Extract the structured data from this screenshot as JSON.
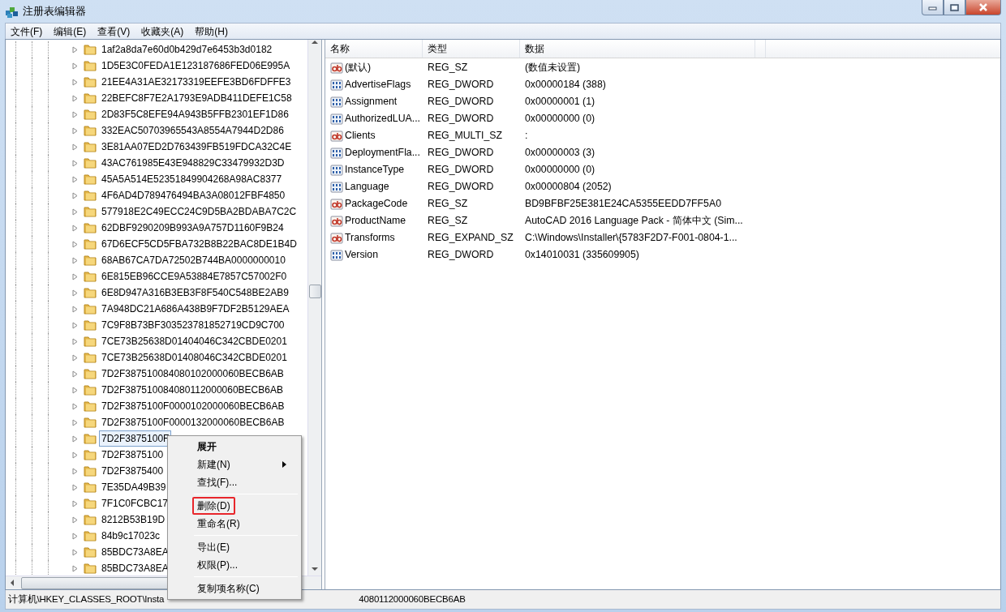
{
  "window": {
    "title": "注册表编辑器"
  },
  "menu_bar": [
    "文件(F)",
    "编辑(E)",
    "查看(V)",
    "收藏夹(A)",
    "帮助(H)"
  ],
  "tree": {
    "items": [
      {
        "label": "1af2a8da7e60d0b429d7e6453b3d0182",
        "selected": false
      },
      {
        "label": "1D5E3C0FEDA1E123187686FED06E995A",
        "selected": false
      },
      {
        "label": "21EE4A31AE32173319EEFE3BD6FDFFE3",
        "selected": false
      },
      {
        "label": "22BEFC8F7E2A1793E9ADB411DEFE1C58",
        "selected": false
      },
      {
        "label": "2D83F5C8EFE94A943B5FFB2301EF1D86",
        "selected": false
      },
      {
        "label": "332EAC50703965543A8554A7944D2D86",
        "selected": false
      },
      {
        "label": "3E81AA07ED2D763439FB519FDCA32C4E",
        "selected": false
      },
      {
        "label": "43AC761985E43E948829C33479932D3D",
        "selected": false
      },
      {
        "label": "45A5A514E52351849904268A98AC8377",
        "selected": false
      },
      {
        "label": "4F6AD4D789476494BA3A08012FBF4850",
        "selected": false
      },
      {
        "label": "577918E2C49ECC24C9D5BA2BDABA7C2C",
        "selected": false
      },
      {
        "label": "62DBF9290209B993A9A757D1160F9B24",
        "selected": false
      },
      {
        "label": "67D6ECF5CD5FBA732B8B22BAC8DE1B4D",
        "selected": false
      },
      {
        "label": "68AB67CA7DA72502B744BA0000000010",
        "selected": false
      },
      {
        "label": "6E815EB96CCE9A53884E7857C57002F0",
        "selected": false
      },
      {
        "label": "6E8D947A316B3EB3F8F540C548BE2AB9",
        "selected": false
      },
      {
        "label": "7A948DC21A686A438B9F7DF2B5129AEA",
        "selected": false
      },
      {
        "label": "7C9F8B73BF303523781852719CD9C700",
        "selected": false
      },
      {
        "label": "7CE73B25638D01404046C342CBDE0201",
        "selected": false
      },
      {
        "label": "7CE73B25638D01408046C342CBDE0201",
        "selected": false
      },
      {
        "label": "7D2F387510084080102000060BECB6AB",
        "selected": false
      },
      {
        "label": "7D2F387510084080112000060BECB6AB",
        "selected": false
      },
      {
        "label": "7D2F3875100F0000102000060BECB6AB",
        "selected": false
      },
      {
        "label": "7D2F3875100F0000132000060BECB6AB",
        "selected": false
      },
      {
        "label": "7D2F3875100F",
        "selected": true
      },
      {
        "label": "7D2F3875100",
        "selected": false
      },
      {
        "label": "7D2F3875400",
        "selected": false
      },
      {
        "label": "7E35DA49B39",
        "selected": false
      },
      {
        "label": "7F1C0FCBC17",
        "selected": false
      },
      {
        "label": "8212B53B19D",
        "selected": false
      },
      {
        "label": "84b9c17023c",
        "selected": false
      },
      {
        "label": "85BDC73A8EA",
        "selected": false
      },
      {
        "label": "85BDC73A8EA",
        "selected": false
      }
    ]
  },
  "table": {
    "columns": [
      "名称",
      "类型",
      "数据"
    ],
    "rows": [
      {
        "kind": "string",
        "name": "(默认)",
        "type": "REG_SZ",
        "data": "(数值未设置)"
      },
      {
        "kind": "binary",
        "name": "AdvertiseFlags",
        "type": "REG_DWORD",
        "data": "0x00000184 (388)"
      },
      {
        "kind": "binary",
        "name": "Assignment",
        "type": "REG_DWORD",
        "data": "0x00000001 (1)"
      },
      {
        "kind": "binary",
        "name": "AuthorizedLUA...",
        "type": "REG_DWORD",
        "data": "0x00000000 (0)"
      },
      {
        "kind": "string",
        "name": "Clients",
        "type": "REG_MULTI_SZ",
        "data": ":"
      },
      {
        "kind": "binary",
        "name": "DeploymentFla...",
        "type": "REG_DWORD",
        "data": "0x00000003 (3)"
      },
      {
        "kind": "binary",
        "name": "InstanceType",
        "type": "REG_DWORD",
        "data": "0x00000000 (0)"
      },
      {
        "kind": "binary",
        "name": "Language",
        "type": "REG_DWORD",
        "data": "0x00000804 (2052)"
      },
      {
        "kind": "string",
        "name": "PackageCode",
        "type": "REG_SZ",
        "data": "BD9BFBF25E381E24CA5355EEDD7FF5A0"
      },
      {
        "kind": "string",
        "name": "ProductName",
        "type": "REG_SZ",
        "data": "AutoCAD 2016 Language Pack - 简体中文 (Sim..."
      },
      {
        "kind": "string",
        "name": "Transforms",
        "type": "REG_EXPAND_SZ",
        "data": "C:\\Windows\\Installer\\{5783F2D7-F001-0804-1..."
      },
      {
        "kind": "binary",
        "name": "Version",
        "type": "REG_DWORD",
        "data": "0x14010031 (335609905)"
      }
    ]
  },
  "context_menu": {
    "items": [
      {
        "kind": "item",
        "label": "展开",
        "bold": true,
        "submenu": false,
        "highlighted": false
      },
      {
        "kind": "item",
        "label": "新建(N)",
        "bold": false,
        "submenu": true,
        "highlighted": false
      },
      {
        "kind": "item",
        "label": "查找(F)...",
        "bold": false,
        "submenu": false,
        "highlighted": false
      },
      {
        "kind": "separator"
      },
      {
        "kind": "item",
        "label": "删除(D)",
        "bold": false,
        "submenu": false,
        "highlighted": true
      },
      {
        "kind": "item",
        "label": "重命名(R)",
        "bold": false,
        "submenu": false,
        "highlighted": false
      },
      {
        "kind": "separator"
      },
      {
        "kind": "item",
        "label": "导出(E)",
        "bold": false,
        "submenu": false,
        "highlighted": false
      },
      {
        "kind": "item",
        "label": "权限(P)...",
        "bold": false,
        "submenu": false,
        "highlighted": false
      },
      {
        "kind": "separator"
      },
      {
        "kind": "item",
        "label": "复制项名称(C)",
        "bold": false,
        "submenu": false,
        "highlighted": false
      }
    ]
  },
  "status_bar": [
    "计算机\\HKEY_CLASSES_ROOT\\Insta",
    "4080112000060BECB6AB"
  ]
}
